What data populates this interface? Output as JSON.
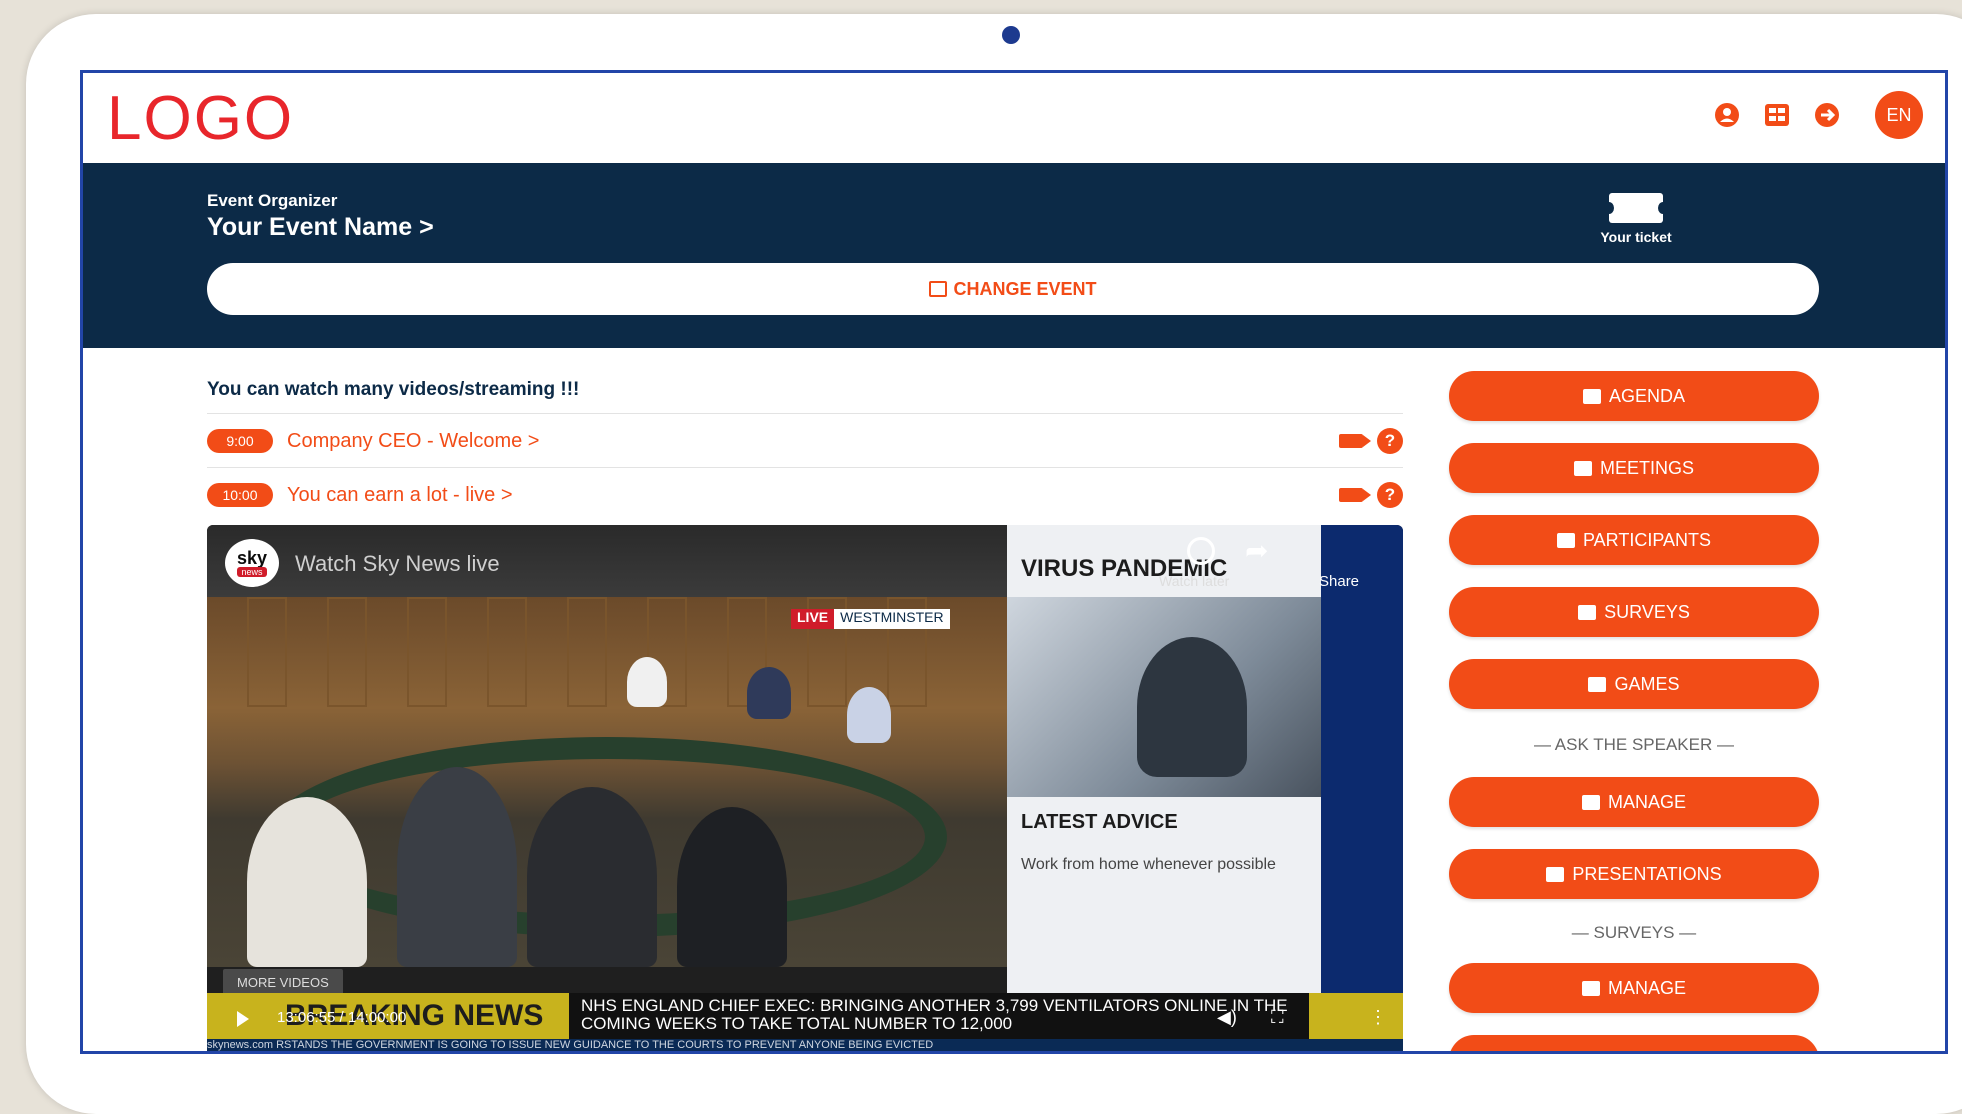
{
  "app": {
    "logo": "LOGO",
    "lang": "EN",
    "icons": [
      "user-icon",
      "grid-icon",
      "logout-icon"
    ]
  },
  "header": {
    "organizer": "Event Organizer",
    "event_name": "Your Event Name >",
    "ticket_label": "Your ticket",
    "change_event": "CHANGE EVENT"
  },
  "main": {
    "intro": "You can watch many videos/streaming !!!",
    "sessions": [
      {
        "time": "9:00",
        "title": "Company CEO - Welcome >"
      },
      {
        "time": "10:00",
        "title": "You can earn a lot - live >"
      }
    ]
  },
  "video": {
    "channel_logo": "sky",
    "channel_sub": "news",
    "title": "Watch Sky News live",
    "live": "LIVE",
    "location": "WESTMINSTER",
    "side_title": "VIRUS PANDEMIC",
    "side_subtitle": "LATEST ADVICE",
    "side_text": "Work from home whenever possible",
    "watch_later": "Watch later",
    "share": "Share",
    "more_videos": "MORE VIDEOS",
    "breaking": "BREAKING NEWS",
    "headline": "NHS ENGLAND CHIEF EXEC: BRINGING ANOTHER 3,799 VENTILATORS ONLINE IN THE COMING WEEKS TO TAKE TOTAL NUMBER TO 12,000",
    "timecode": "13:06:55 / 14:00:00",
    "strap_site": "skynews.com",
    "strap_text": "RSTANDS THE GOVERNMENT IS GOING TO ISSUE NEW GUIDANCE TO THE COURTS TO PREVENT ANYONE BEING EVICTED"
  },
  "sidebar": {
    "buttons": [
      {
        "label": "AGENDA"
      },
      {
        "label": "MEETINGS"
      },
      {
        "label": "PARTICIPANTS"
      },
      {
        "label": "SURVEYS"
      },
      {
        "label": "GAMES"
      }
    ],
    "ask_section": "— ASK THE SPEAKER —",
    "ask_buttons": [
      {
        "label": "MANAGE"
      },
      {
        "label": "PRESENTATIONS"
      }
    ],
    "surveys_section": "— SURVEYS —",
    "surveys_buttons": [
      {
        "label": "MANAGE"
      }
    ]
  },
  "colors": {
    "accent": "#f24c17",
    "navy": "#0c2a47",
    "logo_red": "#e8262b"
  }
}
